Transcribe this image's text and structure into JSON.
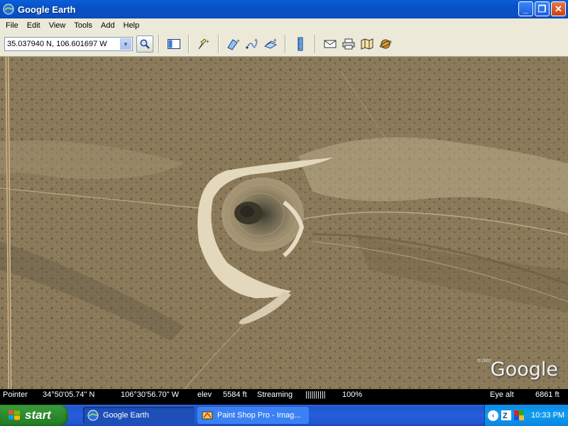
{
  "window": {
    "title": "Google Earth",
    "minimize": "_",
    "restore": "❐",
    "close": "✕"
  },
  "menu": [
    "File",
    "Edit",
    "View",
    "Tools",
    "Add",
    "Help"
  ],
  "toolbar": {
    "location_value": "35.037940 N, 106.601697 W",
    "dropdown_glyph": "▼"
  },
  "map": {
    "watermark": "Google",
    "copyright": "© 2007"
  },
  "status": {
    "pointer_label": "Pointer",
    "lat": "34°50'05.74\" N",
    "lon": "106°30'56.70\" W",
    "elev_label": "elev",
    "elev": "5584 ft",
    "streaming_label": "Streaming",
    "streaming_bars": "||||||||||",
    "streaming_pct": "100%",
    "eye_alt_label": "Eye alt",
    "eye_alt": "6861 ft"
  },
  "taskbar": {
    "start_label": "start",
    "tasks": [
      {
        "label": "Google Earth"
      },
      {
        "label": "Paint Shop Pro - Imag..."
      }
    ],
    "clock": "10:33 PM",
    "colors": {
      "start_green": "#2c8a2c",
      "task_blue": "#245edb",
      "tray_blue": "#109ced"
    }
  }
}
